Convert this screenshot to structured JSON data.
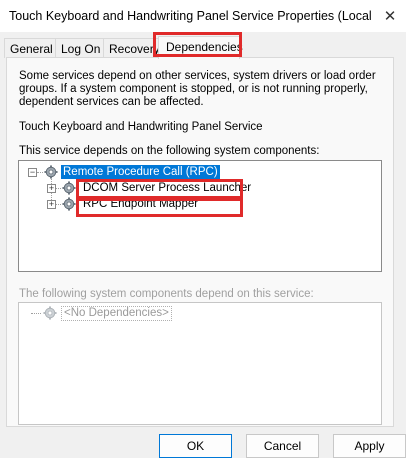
{
  "window": {
    "title": "Touch Keyboard and Handwriting Panel Service Properties (Local C...",
    "close_glyph": "✕"
  },
  "tabs": [
    {
      "label": "General"
    },
    {
      "label": "Log On"
    },
    {
      "label": "Recovery"
    },
    {
      "label": "Dependencies",
      "active": true
    }
  ],
  "dependencies": {
    "description": "Some services depend on other services, system drivers or load order groups. If a system component is stopped, or is not running properly, dependent services can be affected.",
    "service_name": "Touch Keyboard and Handwriting Panel Service",
    "depends_on_label": "This service depends on the following system components:",
    "depends_on_tree": {
      "root": {
        "label": "Remote Procedure Call (RPC)",
        "expanded": true,
        "selected": true
      },
      "children": [
        {
          "label": "DCOM Server Process Launcher",
          "highlighted": true
        },
        {
          "label": "RPC Endpoint Mapper",
          "highlighted": true
        }
      ]
    },
    "dependents_label": "The following system components depend on this service:",
    "dependents_tree": {
      "items": [
        {
          "label": "<No Dependencies>"
        }
      ]
    }
  },
  "buttons": {
    "ok": "OK",
    "cancel": "Cancel",
    "apply": "Apply"
  },
  "colors": {
    "highlight_red": "#e02a2a",
    "selection_blue": "#0078d7"
  }
}
